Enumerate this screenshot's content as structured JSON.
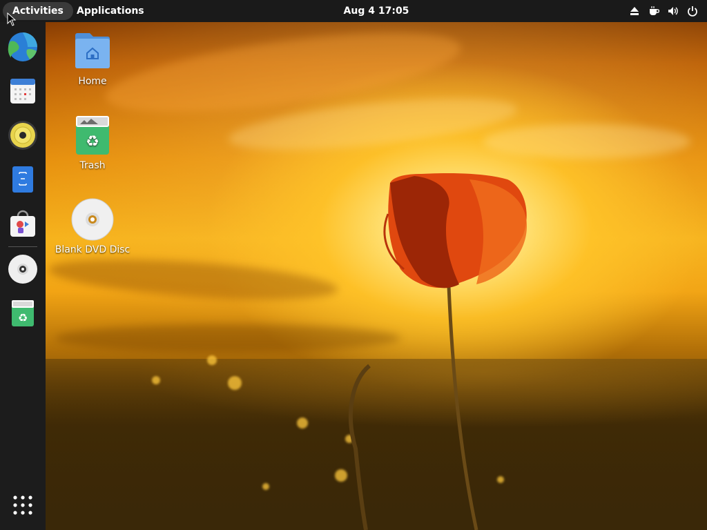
{
  "topbar": {
    "activities": "Activities",
    "applications": "Applications",
    "clock": "Aug 4  17:05",
    "tray_icons": [
      "eject-icon",
      "coffee-cup-icon",
      "volume-icon",
      "power-icon"
    ]
  },
  "dock": {
    "items": [
      {
        "name": "web-browser-icon"
      },
      {
        "name": "calendar-icon"
      },
      {
        "name": "music-player-icon"
      },
      {
        "name": "text-editor-icon"
      },
      {
        "name": "software-store-icon"
      },
      {
        "name": "dvd-disc-icon"
      },
      {
        "name": "trash-icon"
      }
    ],
    "show_apps": "app-grid-icon"
  },
  "desktop": {
    "icons": [
      {
        "label": "Home"
      },
      {
        "label": "Trash"
      },
      {
        "label": "Blank DVD Disc"
      }
    ]
  },
  "colors": {
    "topbar": "#1a1a1a",
    "dock": "#1c1c1c",
    "folder_blue": "#6aa9ec",
    "trash_green": "#3fba6f"
  }
}
